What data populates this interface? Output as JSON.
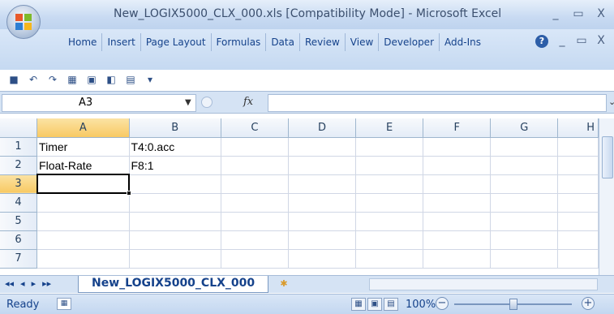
{
  "window": {
    "title": "New_LOGIX5000_CLX_000.xls  [Compatibility Mode] - Microsoft Excel",
    "minimize_glyph": "_",
    "maximize_glyph": "▭",
    "close_glyph": "X"
  },
  "ribbon": {
    "tabs": [
      "Home",
      "Insert",
      "Page Layout",
      "Formulas",
      "Data",
      "Review",
      "View",
      "Developer",
      "Add-Ins"
    ],
    "help_glyph": "?",
    "minimize_glyph": "_",
    "restore_glyph": "▭",
    "close_glyph": "X"
  },
  "qat": {
    "icons": [
      "save-icon",
      "undo-icon",
      "redo-icon",
      "format-icon",
      "print-preview-icon",
      "quick-print-icon",
      "form-icon",
      "customize-qat-icon"
    ],
    "glyphs": [
      "■",
      "↶",
      "↷",
      "▦",
      "▣",
      "◧",
      "▤",
      "▾"
    ]
  },
  "formula_bar": {
    "name_box": "A3",
    "fx_label": "fx",
    "formula": "",
    "expand_glyph": "⌄"
  },
  "sheet": {
    "columns": [
      "A",
      "B",
      "C",
      "D",
      "E",
      "F",
      "G",
      "H"
    ],
    "rows": [
      {
        "num": "1",
        "cells": [
          "Timer",
          "T4:0.acc",
          "",
          "",
          "",
          "",
          "",
          ""
        ]
      },
      {
        "num": "2",
        "cells": [
          "Float-Rate",
          "F8:1",
          "",
          "",
          "",
          "",
          "",
          ""
        ]
      },
      {
        "num": "3",
        "cells": [
          "",
          "",
          "",
          "",
          "",
          "",
          "",
          ""
        ]
      },
      {
        "num": "4",
        "cells": [
          "",
          "",
          "",
          "",
          "",
          "",
          "",
          ""
        ]
      },
      {
        "num": "5",
        "cells": [
          "",
          "",
          "",
          "",
          "",
          "",
          "",
          ""
        ]
      },
      {
        "num": "6",
        "cells": [
          "",
          "",
          "",
          "",
          "",
          "",
          "",
          ""
        ]
      },
      {
        "num": "7",
        "cells": [
          "",
          "",
          "",
          "",
          "",
          "",
          "",
          ""
        ]
      }
    ],
    "active_cell": "A3"
  },
  "sheet_tabs": {
    "nav_glyphs": [
      "◂◂",
      "◂",
      "▸",
      "▸▸"
    ],
    "active_tab": "New_LOGIX5000_CLX_000",
    "insert_glyph": "✱"
  },
  "status_bar": {
    "status": "Ready",
    "macro_glyph": "▦",
    "view_glyphs": [
      "▦",
      "▣",
      "▤"
    ],
    "zoom": "100%",
    "zoom_out": "−",
    "zoom_in": "+",
    "zoom_fraction": 0.5
  }
}
